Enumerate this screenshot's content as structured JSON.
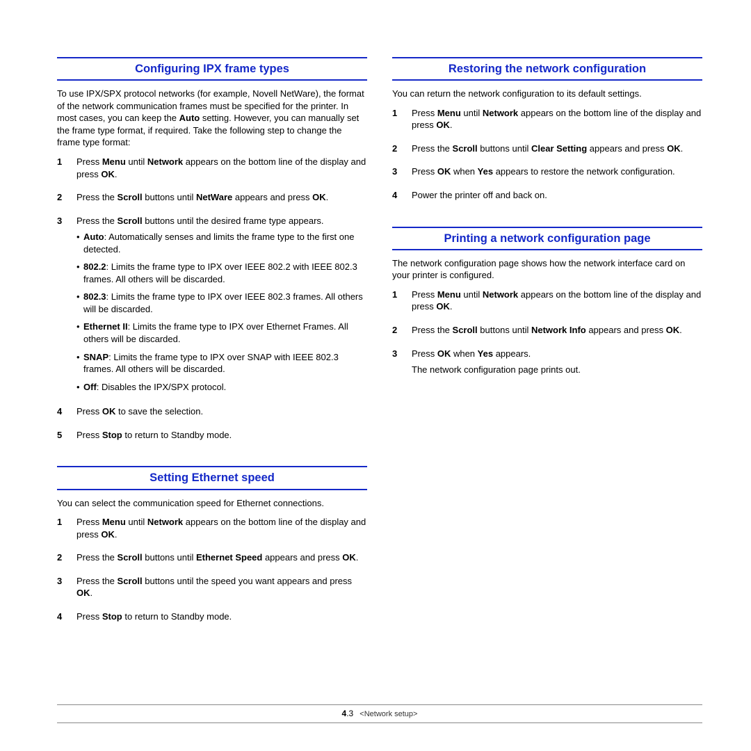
{
  "left": {
    "s1": {
      "title": "Configuring IPX frame types",
      "intro_html": "To use IPX/SPX protocol networks (for example, Novell NetWare), the format of the network communication frames must be specified for the printer. In most cases, you can keep the <b>Auto</b> setting. However, you can manually set the frame type format, if required. Take the following step to change the frame type format:",
      "steps": [
        {
          "n": "1",
          "html": "Press <b>Menu</b> until <b>Network</b> appears on the bottom line of the display and press <b>OK</b>."
        },
        {
          "n": "2",
          "html": "Press the <b>Scroll</b> buttons until <b>NetWare</b> appears and press <b>OK</b>."
        },
        {
          "n": "3",
          "html": "Press the <b>Scroll</b> buttons until the desired frame type appears.",
          "bullets": [
            "<b>Auto</b>: Automatically senses and limits the frame type to the first one detected.",
            "<b>802.2</b>: Limits the frame type to IPX over IEEE 802.2 with IEEE 802.3 frames. All others will be discarded.",
            "<b>802.3</b>: Limits the frame type to IPX over IEEE 802.3 frames. All others will be discarded.",
            "<b>Ethernet II</b>: Limits the frame type to IPX over Ethernet Frames. All others will be discarded.",
            "<b>SNAP</b>: Limits the frame type to IPX over SNAP with IEEE 802.3 frames. All others will be discarded.",
            "<b>Off</b>: Disables the IPX/SPX protocol."
          ]
        },
        {
          "n": "4",
          "html": "Press <b>OK</b> to save the selection."
        },
        {
          "n": "5",
          "html": "Press <b>Stop</b> to return to Standby mode."
        }
      ]
    },
    "s2": {
      "title": "Setting Ethernet speed",
      "intro_html": "You can select the communication speed for Ethernet connections.",
      "steps": [
        {
          "n": "1",
          "html": "Press <b>Menu</b> until <b>Network</b> appears on the bottom line of the display and press <b>OK</b>."
        },
        {
          "n": "2",
          "html": "Press the <b>Scroll</b> buttons until <b>Ethernet Speed</b> appears and press <b>OK</b>."
        },
        {
          "n": "3",
          "html": "Press the <b>Scroll</b> buttons until the speed you want appears and press <b>OK</b>."
        },
        {
          "n": "4",
          "html": "Press <b>Stop</b> to return to Standby mode."
        }
      ]
    }
  },
  "right": {
    "s1": {
      "title": "Restoring the network configuration",
      "intro_html": "You can return the network configuration to its default settings.",
      "steps": [
        {
          "n": "1",
          "html": "Press <b>Menu</b> until <b>Network</b> appears on the bottom line of the display and press <b>OK</b>."
        },
        {
          "n": "2",
          "html": "Press the <b>Scroll</b> buttons until <b>Clear Setting</b> appears and press <b>OK</b>."
        },
        {
          "n": "3",
          "html": "Press <b>OK</b> when <b>Yes</b> appears to restore the network configuration."
        },
        {
          "n": "4",
          "html": "Power the printer off and back on."
        }
      ]
    },
    "s2": {
      "title": "Printing a network configuration page",
      "intro_html": "The network configuration page shows how the network interface card on your printer is configured.",
      "steps": [
        {
          "n": "1",
          "html": "Press <b>Menu</b> until <b>Network</b> appears on the bottom line of the display and press <b>OK</b>."
        },
        {
          "n": "2",
          "html": "Press the <b>Scroll</b> buttons until <b>Network Info</b> appears and press <b>OK</b>."
        },
        {
          "n": "3",
          "html": "Press <b>OK</b> when <b>Yes</b> appears.",
          "after": "The network configuration page prints out."
        }
      ]
    }
  },
  "footer": {
    "chapter": "4",
    "page": ".3",
    "section": "<Network setup>"
  }
}
